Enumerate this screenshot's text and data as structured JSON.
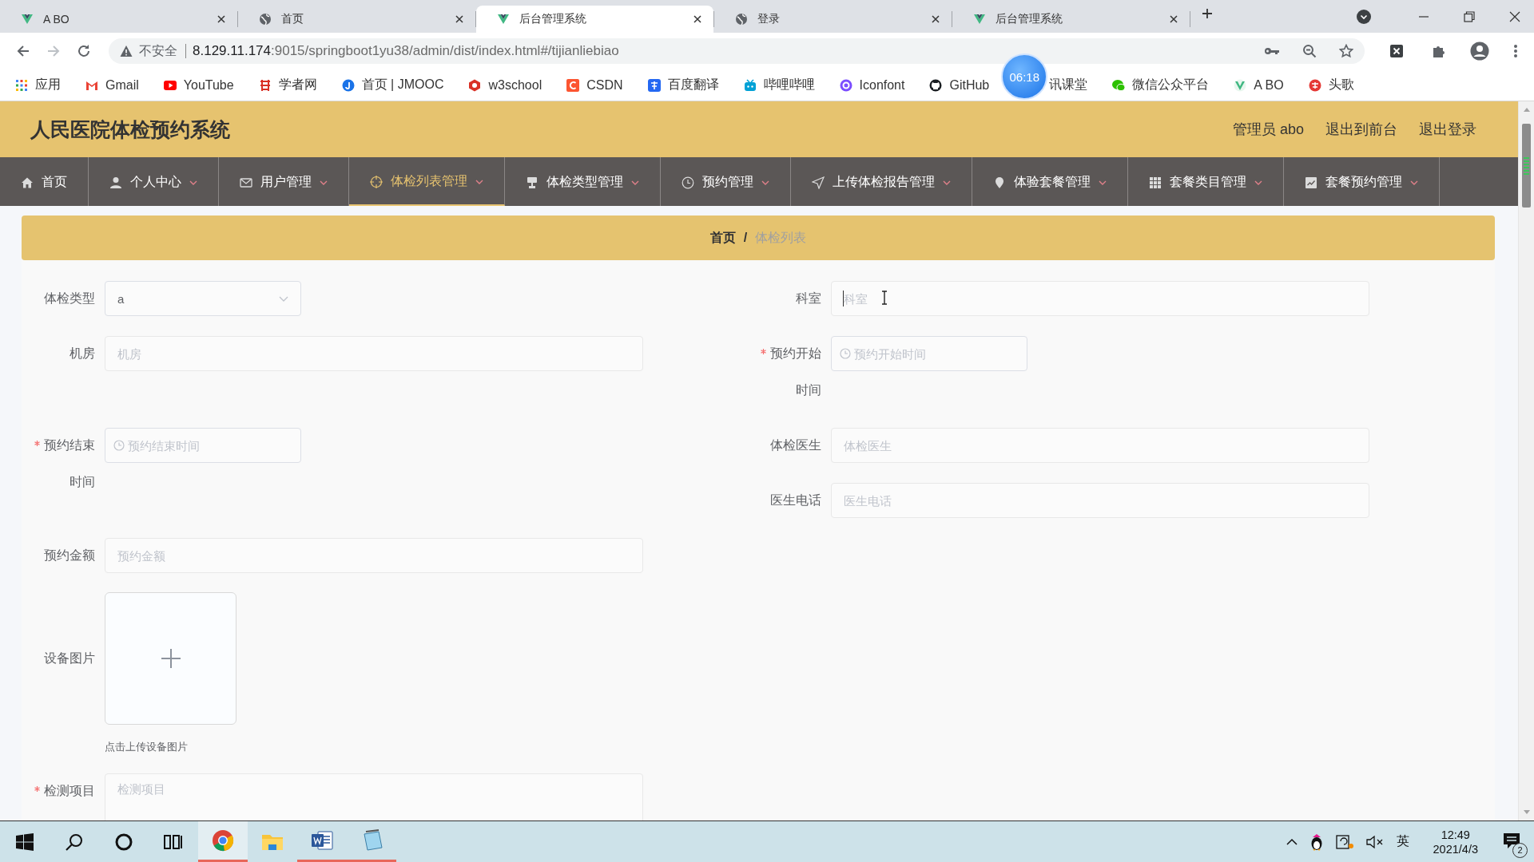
{
  "browser": {
    "tabs": [
      {
        "title": "A BO",
        "selected": false
      },
      {
        "title": "首页",
        "selected": false
      },
      {
        "title": "后台管理系统",
        "selected": true
      },
      {
        "title": "登录",
        "selected": false
      },
      {
        "title": "后台管理系统",
        "selected": false
      }
    ],
    "security": "不安全",
    "url": {
      "host": "8.129.11.174",
      "rest": ":9015/springboot1yu38/admin/dist/index.html#/tijianliebiao"
    },
    "bookmarks": [
      "应用",
      "Gmail",
      "YouTube",
      "学者网",
      "首页 | JMOOC",
      "w3school",
      "CSDN",
      "百度翻译",
      "哔哩哔哩",
      "Iconfont",
      "GitHub",
      "讯课堂",
      "微信公众平台",
      "A BO",
      "头歌"
    ],
    "recorder_timer": "06:18"
  },
  "app": {
    "title": "人民医院体检预约系统",
    "user_links": [
      "管理员 abo",
      "退出到前台",
      "退出登录"
    ]
  },
  "nav": [
    {
      "label": "首页",
      "selected": false,
      "dropdown": false
    },
    {
      "label": "个人中心",
      "selected": false,
      "dropdown": true
    },
    {
      "label": "用户管理",
      "selected": false,
      "dropdown": true
    },
    {
      "label": "体检列表管理",
      "selected": true,
      "dropdown": true
    },
    {
      "label": "体检类型管理",
      "selected": false,
      "dropdown": true
    },
    {
      "label": "预约管理",
      "selected": false,
      "dropdown": true
    },
    {
      "label": "上传体检报告管理",
      "selected": false,
      "dropdown": true
    },
    {
      "label": "体验套餐管理",
      "selected": false,
      "dropdown": true
    },
    {
      "label": "套餐类目管理",
      "selected": false,
      "dropdown": true
    },
    {
      "label": "套餐预约管理",
      "selected": false,
      "dropdown": true
    }
  ],
  "breadcrumb": {
    "separator": "/",
    "items": [
      {
        "label": "首页",
        "current": false
      },
      {
        "label": "体检列表",
        "current": true
      }
    ]
  },
  "form": {
    "fields": [
      {
        "kind": "select",
        "label": "体检类型",
        "value": "a",
        "required": false
      },
      {
        "kind": "input",
        "label": "科室",
        "placeholder": "科室",
        "required": false,
        "focused": true
      },
      {
        "kind": "input",
        "label": "机房",
        "placeholder": "机房",
        "required": false,
        "focused": false
      },
      {
        "kind": "date",
        "label": "预约开始时间",
        "placeholder": "预约开始时间",
        "required": true
      },
      {
        "kind": "date",
        "label": "预约结束时间",
        "placeholder": "预约结束时间",
        "required": true
      },
      {
        "kind": "input",
        "label": "体检医生",
        "placeholder": "体检医生",
        "required": false,
        "focused": false
      },
      {
        "kind": "input",
        "label": "医生电话",
        "placeholder": "医生电话",
        "required": false,
        "focused": false
      },
      {
        "kind": "input",
        "label": "预约金额",
        "placeholder": "预约金额",
        "required": false,
        "focused": false
      },
      {
        "kind": "upload",
        "label": "设备图片",
        "hint": "点击上传设备图片",
        "required": false
      },
      {
        "kind": "textarea",
        "label": "检测项目",
        "placeholder": "检测项目",
        "required": true
      }
    ]
  },
  "taskbar": {
    "pinned_apps": [
      {
        "active": true,
        "running": true
      },
      {
        "active": false,
        "running": false
      },
      {
        "active": false,
        "running": true
      },
      {
        "active": false,
        "running": true
      }
    ],
    "language": "英",
    "time": "12:49",
    "date": "2021/4/3",
    "notification_count": "2"
  }
}
